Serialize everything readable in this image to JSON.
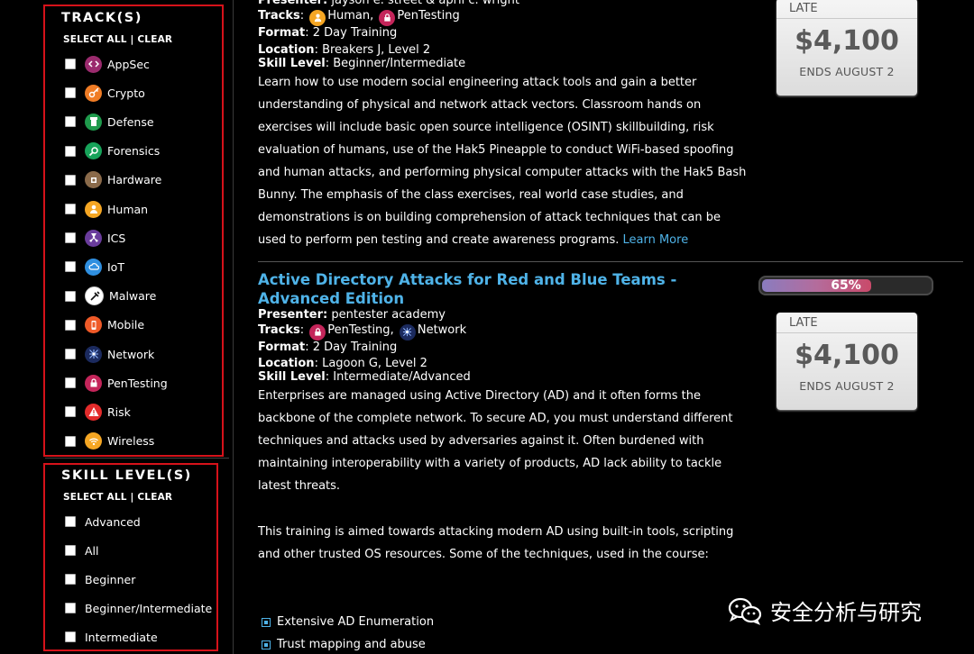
{
  "tracks_filter": {
    "title": "TRACK(S)",
    "select_all": "SELECT ALL",
    "separator": "|",
    "clear": "CLEAR",
    "items": [
      {
        "label": "AppSec",
        "icon": "code-icon",
        "color": "#9b2b6e"
      },
      {
        "label": "Crypto",
        "icon": "key-icon",
        "color": "#f07c25"
      },
      {
        "label": "Defense",
        "icon": "tower-icon",
        "color": "#1f9a4c"
      },
      {
        "label": "Forensics",
        "icon": "magnifier-icon",
        "color": "#17a35a"
      },
      {
        "label": "Hardware",
        "icon": "chip-icon",
        "color": "#8a6a4a"
      },
      {
        "label": "Human",
        "icon": "person-icon",
        "color": "#f5a623"
      },
      {
        "label": "ICS",
        "icon": "radiation-icon",
        "color": "#6a3c9c"
      },
      {
        "label": "IoT",
        "icon": "cloud-icon",
        "color": "#2f8fe0"
      },
      {
        "label": "Malware",
        "icon": "syringe-icon",
        "color": "#ffffff"
      },
      {
        "label": "Mobile",
        "icon": "phone-icon",
        "color": "#ef5a28"
      },
      {
        "label": "Network",
        "icon": "network-icon",
        "color": "#1b2a5e"
      },
      {
        "label": "PenTesting",
        "icon": "lock-icon",
        "color": "#c4255a"
      },
      {
        "label": "Risk",
        "icon": "warning-icon",
        "color": "#e32b2b"
      },
      {
        "label": "Wireless",
        "icon": "wifi-icon",
        "color": "#f5a623"
      }
    ]
  },
  "skill_filter": {
    "title": "SKILL LEVEL(S)",
    "select_all": "SELECT ALL",
    "separator": "|",
    "clear": "CLEAR",
    "items": [
      "Advanced",
      "All",
      "Beginner",
      "Beginner/Intermediate",
      "Intermediate"
    ]
  },
  "course1": {
    "presenter_label": "Presenter:",
    "presenter": "jayson e. street & april c. wright",
    "tracks_label": "Tracks",
    "tracks": [
      "Human",
      "PenTesting"
    ],
    "track_sep": ",",
    "format_label": "Format",
    "format": "2 Day Training",
    "location_label": "Location",
    "location": "Breakers J, Level 2",
    "skill_label": "Skill Level",
    "skill": "Beginner/Intermediate",
    "description": "Learn how to use modern social engineering attack tools and gain a better understanding of physical and network attack vectors. Classroom hands on exercises will include basic open source intelligence (OSINT) skillbuilding, risk evaluation of humans, use of the Hak5 Pineapple to conduct WiFi-based spoofing and human attacks, and performing physical computer attacks with the Hak5 Bash Bunny. The emphasis of the class exercises, real world case studies, and demonstrations is on building comprehension of attack techniques that can be used to perform pen testing and create awareness programs.",
    "learn_more": "Learn More",
    "price_tier": "LATE",
    "price": "$4,100",
    "ends": "ENDS AUGUST 2"
  },
  "course2": {
    "title": "Active Directory Attacks for Red and Blue Teams - Advanced Edition",
    "presenter_label": "Presenter:",
    "presenter": "pentester academy",
    "tracks_label": "Tracks",
    "tracks": [
      "PenTesting",
      "Network"
    ],
    "track_sep": ",",
    "format_label": "Format",
    "format": "2 Day Training",
    "location_label": "Location",
    "location": "Lagoon G, Level 2",
    "skill_label": "Skill Level",
    "skill": "Intermediate/Advanced",
    "description": "Enterprises are managed using Active Directory (AD) and it often forms the backbone of the complete network. To secure AD, you must understand different techniques and attacks used by adversaries against it. Often burdened with maintaining interoperability with a variety of products, AD lack ability to tackle latest threats.",
    "description2": "This training is aimed towards attacking modern AD using built-in tools, scripting and other trusted OS resources. Some of the techniques, used in the course:",
    "bullets": [
      "Extensive AD Enumeration",
      "Trust mapping and abuse"
    ],
    "progress_percent": 65,
    "progress_label": "65%",
    "price_tier": "LATE",
    "price": "$4,100",
    "ends": "ENDS AUGUST 2"
  },
  "watermark": "安全分析与研究"
}
